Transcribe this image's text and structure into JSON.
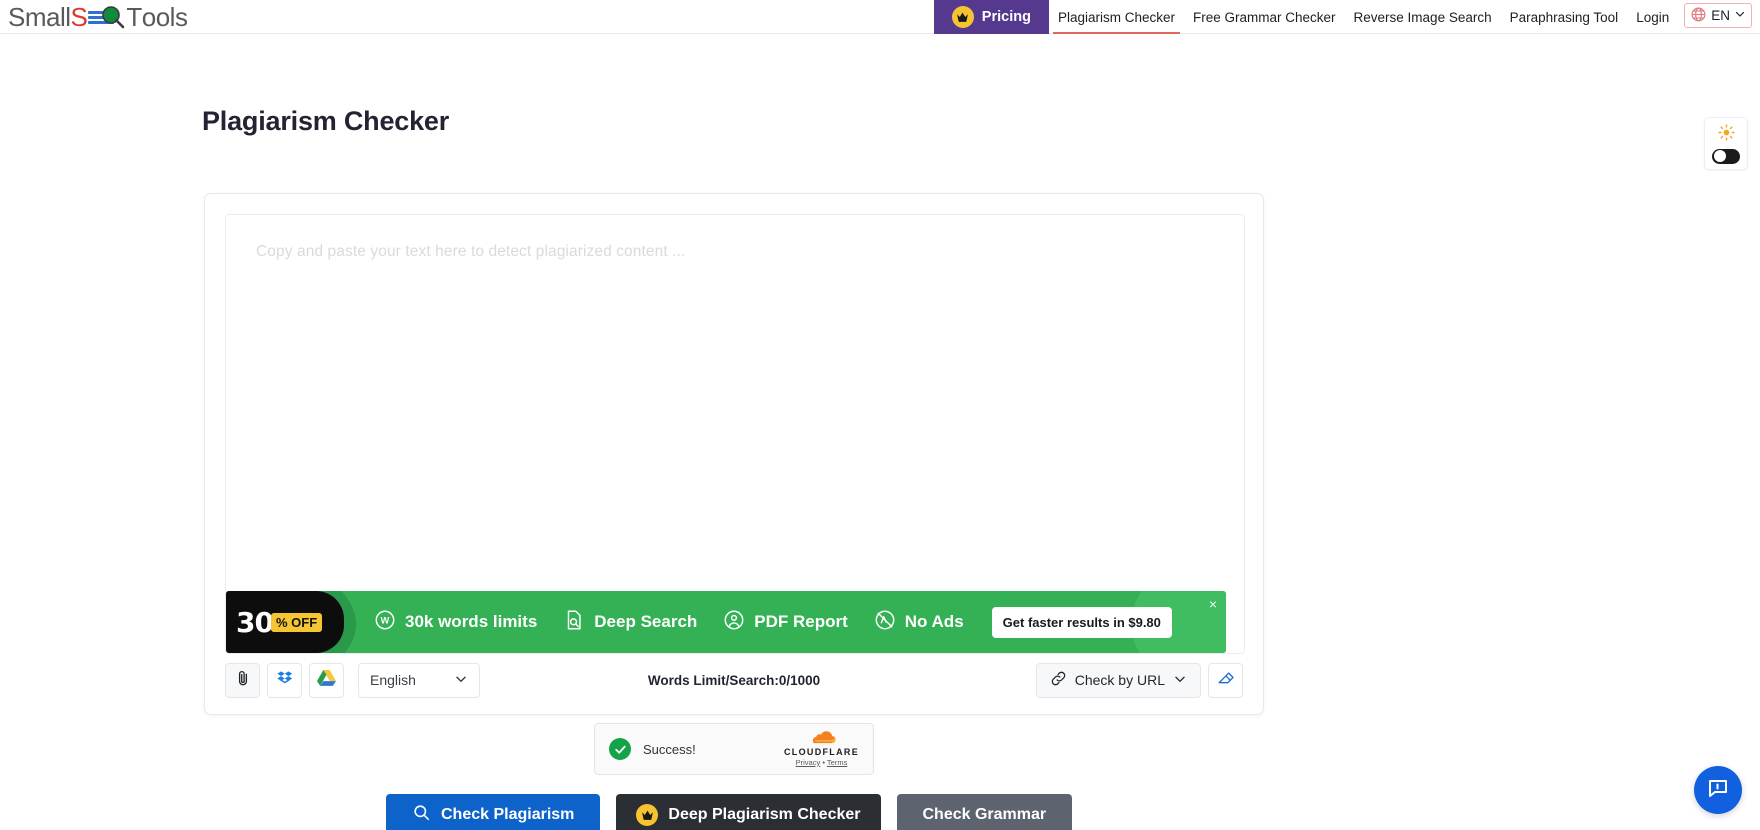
{
  "brand": {
    "name_part1": "Small",
    "name_s": "S",
    "name_part2": "T",
    "name_part3": "ools",
    "logo_colors": {
      "red": "#d93a2b",
      "blue": "#2f6fd0",
      "green": "#128a3e",
      "gray": "#5a5a5a"
    }
  },
  "nav": {
    "pricing_label": "Pricing",
    "items": [
      {
        "label": "Plagiarism Checker",
        "active": true
      },
      {
        "label": "Free Grammar Checker",
        "active": false
      },
      {
        "label": "Reverse Image Search",
        "active": false
      },
      {
        "label": "Paraphrasing Tool",
        "active": false
      },
      {
        "label": "Login",
        "active": false
      }
    ],
    "language": "EN",
    "active_underline_color": "#e2685f",
    "pricing_bg": "#55398f"
  },
  "page": {
    "title": "Plagiarism Checker"
  },
  "theme_toggle": {
    "icon": "sun-icon",
    "state": "light"
  },
  "editor": {
    "placeholder": "Copy and paste your text here to detect plagiarized content ...",
    "value": ""
  },
  "promo": {
    "discount_number": "30",
    "discount_suffix": "% OFF",
    "features": [
      {
        "icon": "word-count-icon",
        "label": "30k words limits"
      },
      {
        "icon": "deep-search-icon",
        "label": "Deep Search"
      },
      {
        "icon": "pdf-report-icon",
        "label": "PDF Report"
      },
      {
        "icon": "no-ads-icon",
        "label": "No Ads"
      }
    ],
    "cta_label": "Get faster results in $9.80",
    "close_label": "×",
    "bg_color": "#34b155"
  },
  "toolbar": {
    "upload_icon": "paperclip-icon",
    "dropbox_icon": "dropbox-icon",
    "gdrive_icon": "google-drive-icon",
    "language_value": "English",
    "word_limit_text": "Words Limit/Search:0/1000",
    "check_url_label": "Check by URL",
    "erase_icon": "eraser-icon"
  },
  "turnstile": {
    "status": "Success!",
    "brand": "CLOUDFLARE",
    "privacy": "Privacy",
    "separator": "•",
    "terms": "Terms"
  },
  "actions": {
    "check_plagiarism": "Check Plagiarism",
    "deep_plagiarism": "Deep Plagiarism Checker",
    "check_grammar": "Check Grammar",
    "colors": {
      "blue": "#0d63c9",
      "dark": "#2b2e33",
      "gray": "#5d636f",
      "crown": "#f7c331"
    }
  },
  "chat": {
    "icon": "chat-bubble-icon",
    "color": "#1060e0"
  }
}
